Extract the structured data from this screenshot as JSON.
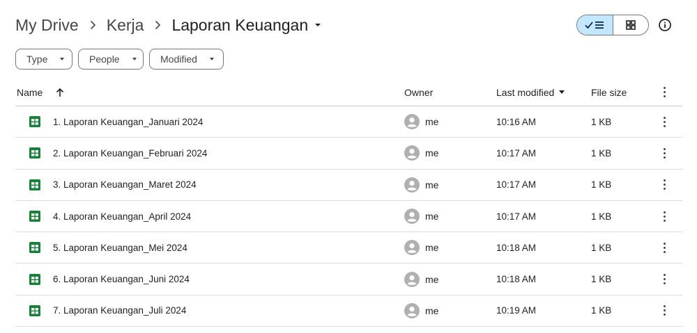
{
  "breadcrumb": {
    "items": [
      "My Drive",
      "Kerja"
    ],
    "current": "Laporan Keuangan"
  },
  "filters": [
    {
      "label": "Type"
    },
    {
      "label": "People"
    },
    {
      "label": "Modified"
    }
  ],
  "view": {
    "active": "list",
    "icons": [
      "check-list-icon",
      "grid-icon"
    ]
  },
  "table": {
    "headers": {
      "name": "Name",
      "owner": "Owner",
      "modified": "Last modified",
      "size": "File size"
    },
    "rows": [
      {
        "name": "1. Laporan Keuangan_Januari 2024",
        "owner": "me",
        "modified": "10:16 AM",
        "size": "1 KB"
      },
      {
        "name": "2. Laporan Keuangan_Februari 2024",
        "owner": "me",
        "modified": "10:17 AM",
        "size": "1 KB"
      },
      {
        "name": "3. Laporan Keuangan_Maret 2024",
        "owner": "me",
        "modified": "10:17 AM",
        "size": "1 KB"
      },
      {
        "name": "4. Laporan Keuangan_April 2024",
        "owner": "me",
        "modified": "10:17 AM",
        "size": "1 KB"
      },
      {
        "name": "5. Laporan Keuangan_Mei 2024",
        "owner": "me",
        "modified": "10:18 AM",
        "size": "1 KB"
      },
      {
        "name": "6. Laporan Keuangan_Juni 2024",
        "owner": "me",
        "modified": "10:18 AM",
        "size": "1 KB"
      },
      {
        "name": "7. Laporan Keuangan_Juli 2024",
        "owner": "me",
        "modified": "10:19 AM",
        "size": "1 KB"
      }
    ]
  },
  "colors": {
    "sheets_green": "#188038",
    "active_toggle": "#c2e7ff",
    "avatar_gray": "#b0b0b0"
  }
}
